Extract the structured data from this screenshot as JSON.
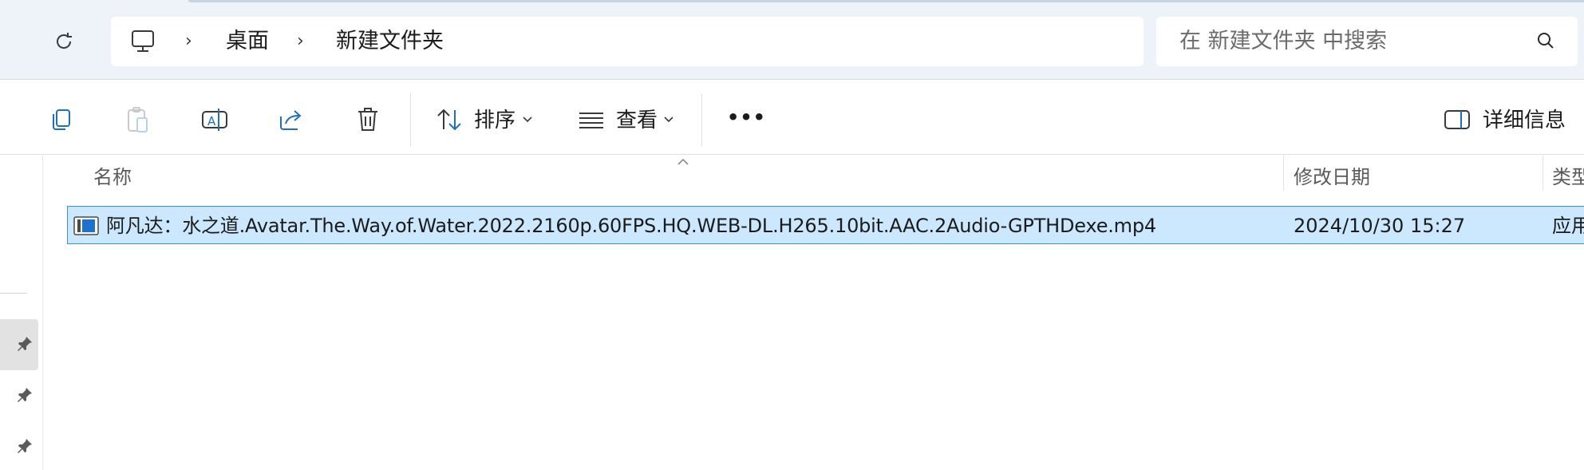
{
  "breadcrumb": {
    "items": [
      "桌面",
      "新建文件夹"
    ]
  },
  "search": {
    "placeholder": "在 新建文件夹 中搜索"
  },
  "toolbar": {
    "sort_label": "排序",
    "view_label": "查看",
    "more_label": "•••",
    "details_label": "详细信息"
  },
  "columns": {
    "name": "名称",
    "modified": "修改日期",
    "type": "类型"
  },
  "files": [
    {
      "name": "阿凡达：水之道.Avatar.The.Way.of.Water.2022.2160p.60FPS.HQ.WEB-DL.H265.10bit.AAC.2Audio-GPTHDexe.mp4",
      "modified": "2024/10/30 15:27",
      "type": "应用"
    }
  ],
  "icons": {
    "refresh": "refresh-icon",
    "pc": "this-pc-icon",
    "search": "search-icon",
    "copy": "copy-icon",
    "paste": "paste-icon",
    "rename": "rename-icon",
    "share": "share-icon",
    "delete": "delete-icon",
    "sort": "sort-icon",
    "view": "view-icon",
    "details": "details-pane-icon",
    "pin": "pin-icon",
    "video": "video-file-icon"
  },
  "colors": {
    "selection_bg": "#cce8ff",
    "selection_border": "#3d8fd6",
    "address_bg": "#eef2f9",
    "accent": "#0067c0"
  }
}
